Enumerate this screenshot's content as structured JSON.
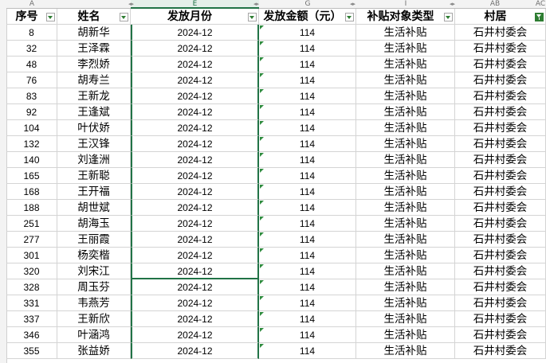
{
  "column_letters": [
    "A",
    "",
    "E",
    "G",
    "I",
    "AB",
    "AC"
  ],
  "headers": [
    "序号",
    "姓名",
    "发放月份",
    "发放金额（元）",
    "补贴对象类型",
    "村居"
  ],
  "filter_active": [
    false,
    false,
    false,
    false,
    false,
    true
  ],
  "selected_column": "E",
  "rows": [
    [
      "8",
      "胡新华",
      "2024-12",
      "114",
      "生活补贴",
      "石井村委会"
    ],
    [
      "32",
      "王泽霖",
      "2024-12",
      "114",
      "生活补贴",
      "石井村委会"
    ],
    [
      "48",
      "李烈娇",
      "2024-12",
      "114",
      "生活补贴",
      "石井村委会"
    ],
    [
      "76",
      "胡寿兰",
      "2024-12",
      "114",
      "生活补贴",
      "石井村委会"
    ],
    [
      "83",
      "王新龙",
      "2024-12",
      "114",
      "生活补贴",
      "石井村委会"
    ],
    [
      "92",
      "王逢斌",
      "2024-12",
      "114",
      "生活补贴",
      "石井村委会"
    ],
    [
      "104",
      "叶伏娇",
      "2024-12",
      "114",
      "生活补贴",
      "石井村委会"
    ],
    [
      "132",
      "王汉锋",
      "2024-12",
      "114",
      "生活补贴",
      "石井村委会"
    ],
    [
      "140",
      "刘逢洲",
      "2024-12",
      "114",
      "生活补贴",
      "石井村委会"
    ],
    [
      "165",
      "王新聪",
      "2024-12",
      "114",
      "生活补贴",
      "石井村委会"
    ],
    [
      "168",
      "王开福",
      "2024-12",
      "114",
      "生活补贴",
      "石井村委会"
    ],
    [
      "188",
      "胡世斌",
      "2024-12",
      "114",
      "生活补贴",
      "石井村委会"
    ],
    [
      "251",
      "胡海玉",
      "2024-12",
      "114",
      "生活补贴",
      "石井村委会"
    ],
    [
      "277",
      "王丽霞",
      "2024-12",
      "114",
      "生活补贴",
      "石井村委会"
    ],
    [
      "301",
      "杨奕楷",
      "2024-12",
      "114",
      "生活补贴",
      "石井村委会"
    ],
    [
      "320",
      "刘宋江",
      "2024-12",
      "114",
      "生活补贴",
      "石井村委会"
    ],
    [
      "328",
      "周玉芬",
      "2024-12",
      "114",
      "生活补贴",
      "石井村委会"
    ],
    [
      "331",
      "韦燕芳",
      "2024-12",
      "114",
      "生活补贴",
      "石井村委会"
    ],
    [
      "337",
      "王新欣",
      "2024-12",
      "114",
      "生活补贴",
      "石井村委会"
    ],
    [
      "346",
      "叶涵鸿",
      "2024-12",
      "114",
      "生活补贴",
      "石井村委会"
    ],
    [
      "355",
      "张益娇",
      "2024-12",
      "114",
      "生活补贴",
      "石井村委会"
    ]
  ]
}
